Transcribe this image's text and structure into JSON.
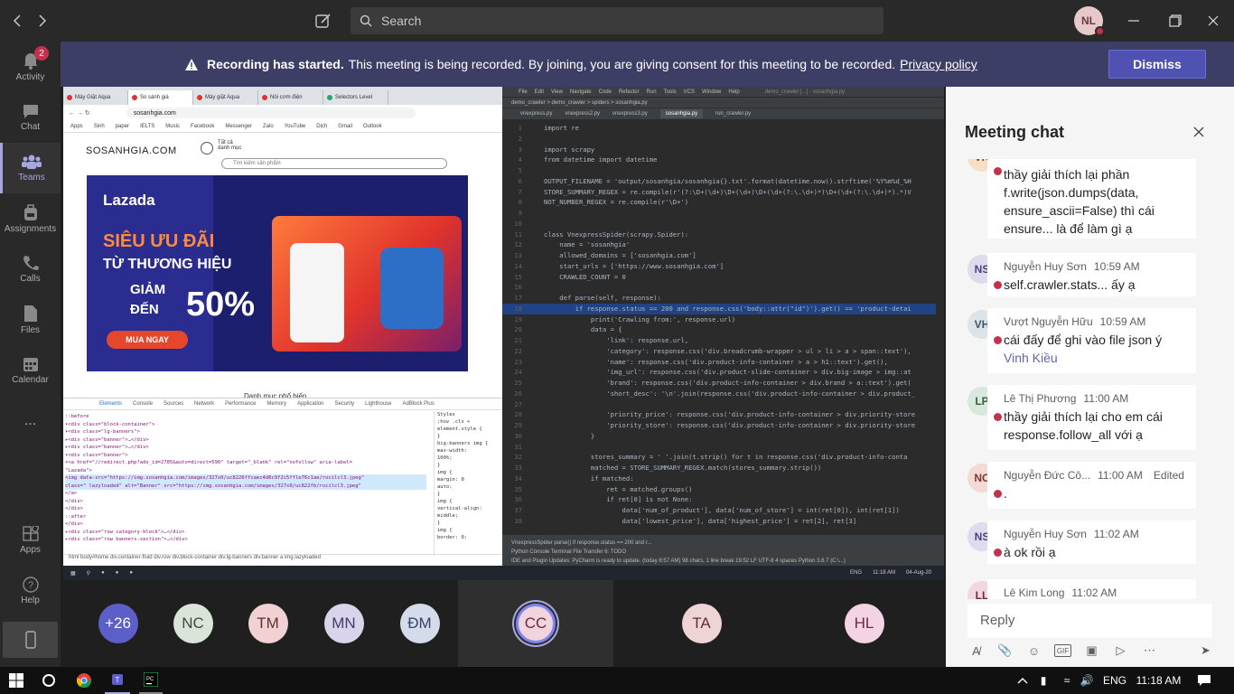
{
  "topbar": {
    "search_placeholder": "Search",
    "user_initials": "NL"
  },
  "rail": {
    "items": [
      {
        "label": "Activity",
        "icon": "bell-icon",
        "badge": "2"
      },
      {
        "label": "Chat",
        "icon": "chat-icon"
      },
      {
        "label": "Teams",
        "icon": "teams-icon"
      },
      {
        "label": "Assignments",
        "icon": "backpack-icon"
      },
      {
        "label": "Calls",
        "icon": "phone-icon"
      },
      {
        "label": "Files",
        "icon": "files-icon"
      },
      {
        "label": "Calendar",
        "icon": "calendar-icon"
      },
      {
        "label": "...",
        "icon": "more-icon"
      },
      {
        "label": "Apps",
        "icon": "apps-icon"
      },
      {
        "label": "Help",
        "icon": "help-icon"
      }
    ]
  },
  "banner": {
    "bold": "Recording has started.",
    "text": "This meeting is being recorded. By joining, you are giving consent for this meeting to be recorded.",
    "link": "Privacy policy",
    "dismiss": "Dismiss"
  },
  "shared": {
    "browser_tabs": [
      "Máy Giặt Aqua",
      "So sánh giá",
      "Máy giặt Aqua",
      "Nồi cơm điện",
      "Selectors Level"
    ],
    "url": "sosanhgia.com",
    "bookmarks": [
      "Apps",
      "Sinh",
      "paper",
      "IELTS",
      "Music",
      "Facebook",
      "Messenger",
      "Zalo",
      "YouTube",
      "Dịch",
      "Gmail",
      "Outlook"
    ],
    "site_logo": "SOSANHGIA.COM",
    "site_menu": "Tất cả danh mục",
    "site_search_placeholder": "Tìm kiếm sản phẩm",
    "ad": {
      "brand": "Lazada",
      "line1": "SIÊU ƯU ĐÃI",
      "line2": "TỪ THƯƠNG HIỆU",
      "line3": "GIẢM",
      "percent": "50%",
      "line4": "ĐẾN",
      "cta": "MUA NGAY"
    },
    "caption": "Danh mục phổ biến",
    "devtools_tabs": [
      "Elements",
      "Console",
      "Sources",
      "Network",
      "Performance",
      "Memory",
      "Application",
      "Security",
      "Lighthouse",
      "AdBlock Plus"
    ],
    "devtools_lines": [
      "::before",
      "▾<div class=\"block-container\">",
      "  ▾<div class=\"lg-banners\">",
      "    ▸<div class=\"banner\">…</div>",
      "    ▸<div class=\"banner\">…</div>",
      "    ▾<div class=\"banner\">",
      "      ▾<a href=\"//redirect.php?ads_id=2785&auto=direct=590\" target=\"_blank\" rel=\"nofollow\" aria-label=",
      "        \"Lazada\">",
      "        <img data-src=\"https://img.sosanhgia.com/images/327x0/uc8226ffcaec4d8c9f2c5ffle76c1ae/rocilcl3.jpeg\"",
      "        class=\" lazyloaded\" alt=\"Banner\" src=\"https://img.sosanhgia.com/images/327x0/uc822fb/rocilcl3.jpeg\"",
      "      </a>",
      "    </div>",
      "  </div>",
      "  ::after",
      "</div>",
      "▸<div class=\"row category-block\">…</div>",
      "▸<div class=\"row banners-section\">…</div>"
    ],
    "devtools_styles": [
      "Styles",
      ":hov .cls +",
      "element.style {",
      "}",
      "big-banners img {",
      "  max-width:",
      "  100%;",
      "}",
      "img {",
      "  margin: 0",
      "  auto;",
      "}",
      "img {",
      "  vertical-align:",
      "  middle;",
      "}",
      "img {",
      "  border: 0;"
    ],
    "devtools_crumbs": "html  body#home  div.container-fluid  div.row  div.block-container  div.lg-banners  div.banner  a  img.lazyloaded",
    "ide_menu": [
      "File",
      "Edit",
      "View",
      "Navigate",
      "Code",
      "Refactor",
      "Run",
      "Tools",
      "VCS",
      "Window",
      "Help"
    ],
    "ide_title": "demo_crawler [...] - sosanhgia.py",
    "ide_breadcrumb": "demo_crawler > demo_crawler > spiders > sosanhgia.py",
    "ide_tabs": [
      "vnexpress.py",
      "vnexpress2.py",
      "vnexpress3.py",
      "sosanhgia.py",
      "run_crawler.py"
    ],
    "ide_code": [
      {
        "n": "1",
        "t": "import re"
      },
      {
        "n": "2",
        "t": ""
      },
      {
        "n": "3",
        "t": "import scrapy"
      },
      {
        "n": "4",
        "t": "from datetime import datetime"
      },
      {
        "n": "5",
        "t": ""
      },
      {
        "n": "6",
        "t": "OUTPUT_FILENAME = 'output/sosanhgia/sosanhgia{}.txt'.format(datetime.now().strftime('%Y%m%d_%H"
      },
      {
        "n": "7",
        "t": "STORE_SUMMARY_REGEX = re.compile(r'(?:\\D+(\\d+)\\D+(\\d+)\\D+(\\d+(?:\\.\\d+)*)\\D+(\\d+(?:\\.\\d+)*).*)V"
      },
      {
        "n": "8",
        "t": "NOT_NUMBER_REGEX = re.compile(r'\\D+')"
      },
      {
        "n": "9",
        "t": ""
      },
      {
        "n": "10",
        "t": ""
      },
      {
        "n": "11",
        "t": "class VnexpressSpider(scrapy.Spider):"
      },
      {
        "n": "12",
        "t": "    name = 'sosanhgia'"
      },
      {
        "n": "13",
        "t": "    allowed_domains = ['sosanhgia.com']"
      },
      {
        "n": "14",
        "t": "    start_urls = ['https://www.sosanhgia.com']"
      },
      {
        "n": "15",
        "t": "    CRAWLED_COUNT = 0"
      },
      {
        "n": "16",
        "t": ""
      },
      {
        "n": "17",
        "t": "    def parse(self, response):"
      },
      {
        "n": "18",
        "t": "        if response.status == 200 and response.css('body::attr(\"id\")').get() == 'product-detai"
      },
      {
        "n": "19",
        "t": "            print('Crawling from:', response.url)"
      },
      {
        "n": "20",
        "t": "            data = {"
      },
      {
        "n": "21",
        "t": "                'link': response.url,"
      },
      {
        "n": "22",
        "t": "                'category': response.css('div.breadcrumb-wrapper > ul > li > a > span::text'),"
      },
      {
        "n": "23",
        "t": "                'name': response.css('div.product-info-container > a > h1::text').get(),"
      },
      {
        "n": "24",
        "t": "                'img_url': response.css('div.product-slide-container > div.big-image > img::at"
      },
      {
        "n": "25",
        "t": "                'brand': response.css('div.product-info-container > div.brand > a::text').get("
      },
      {
        "n": "26",
        "t": "                'short_desc': '\\n'.join(response.css('div.product-info-container > div.product_"
      },
      {
        "n": "27",
        "t": ""
      },
      {
        "n": "28",
        "t": "                'priority_price': response.css('div.product-info-container > div.priority-store"
      },
      {
        "n": "29",
        "t": "                'priority_store': response.css('div.product-info-container > div.priority-store"
      },
      {
        "n": "30",
        "t": "            }"
      },
      {
        "n": "31",
        "t": ""
      },
      {
        "n": "32",
        "t": "            stores_summary = ' '.join(t.strip() for t in response.css('div.product-info-conta"
      },
      {
        "n": "33",
        "t": "            matched = STORE_SUMMARY_REGEX.match(stores_summary.strip())"
      },
      {
        "n": "34",
        "t": "            if matched:"
      },
      {
        "n": "35",
        "t": "                ret = matched.groups()"
      },
      {
        "n": "36",
        "t": "                if ret[0] is not None:"
      },
      {
        "n": "37",
        "t": "                    data['num_of_product'], data['num_of_store'] = int(ret[0]), int(ret[1])"
      },
      {
        "n": "38",
        "t": "                    data['lowest_price'], data['highest_price'] = ret[2], ret[3]"
      }
    ],
    "ide_status": "VnexpressSpider  parse()  if response.status == 200 and r...",
    "ide_tools": "Python Console   Terminal   File Transfer   6: TODO",
    "ide_footer": "IDE and Plugin Updates: PyCharm is ready to update. (today 8:57 AM)      98 chars, 1 line break   19:52  LF  UTF-8  4 spaces  Python 3.6.7 (C:\\...)",
    "shared_clock": "11:18 AM",
    "shared_date": "04-Aug-20",
    "shared_lang": "ENG"
  },
  "participants": [
    {
      "initials": "+26",
      "bg": "#5b5fc7",
      "fg": "#ffffff"
    },
    {
      "initials": "NC",
      "bg": "#dbe4d9",
      "fg": "#3e4a3b"
    },
    {
      "initials": "TM",
      "bg": "#f1d1d2",
      "fg": "#5c3334"
    },
    {
      "initials": "MN",
      "bg": "#d9d4ea",
      "fg": "#44396b"
    },
    {
      "initials": "ĐM",
      "bg": "#d4dbeb",
      "fg": "#364466"
    },
    {
      "initials": "CC",
      "bg": "#f2d4de",
      "fg": "#6b2b3e"
    },
    {
      "initials": "TA",
      "bg": "#efd4d6",
      "fg": "#5c3134"
    },
    {
      "initials": "HL",
      "bg": "#f3d3e4",
      "fg": "#6b2848"
    }
  ],
  "chat": {
    "title": "Meeting chat",
    "reply_placeholder": "Reply",
    "messages": [
      {
        "initials": "VK",
        "bg": "#f6dfc6",
        "fg": "#7a4a1f",
        "name": "",
        "time": "",
        "edited": "",
        "body": "thầy giải thích lại phần f.write(json.dumps(data, ensure_ascii=False) thì cái ensure... là để làm gì ạ",
        "mention": ""
      },
      {
        "initials": "NS",
        "bg": "#dedbec",
        "fg": "#4c4480",
        "name": "Nguyễn Huy Sơn",
        "time": "10:59 AM",
        "edited": "",
        "body": "self.crawler.stats... ấy ạ",
        "mention": ""
      },
      {
        "initials": "VH",
        "bg": "#dce4ea",
        "fg": "#3f5566",
        "name": "Vượt Nguyễn Hữu",
        "time": "10:59 AM",
        "edited": "",
        "body": "cái đấy để ghi vào file json ý",
        "mention": "Vinh Kiều"
      },
      {
        "initials": "LP",
        "bg": "#d8e8dc",
        "fg": "#3a5e44",
        "name": "Lê Thị Phương",
        "time": "11:00 AM",
        "edited": "",
        "body": "thầy giải thích lại cho em cái response.follow_all với ạ",
        "mention": ""
      },
      {
        "initials": "NC",
        "bg": "#f4d9d7",
        "fg": "#7a3a35",
        "name": "Nguyễn Đức Cô...",
        "time": "11:00 AM",
        "edited": "Edited",
        "body": ".",
        "mention": ""
      },
      {
        "initials": "NS",
        "bg": "#dedbec",
        "fg": "#4c4480",
        "name": "Nguyễn Huy Sơn",
        "time": "11:02 AM",
        "edited": "",
        "body": "à ok rồi ạ",
        "mention": ""
      },
      {
        "initials": "LL",
        "bg": "#f3d7de",
        "fg": "#6b2b3e",
        "name": "Lê Kim Long",
        "time": "11:02 AM",
        "edited": "",
        "body": "",
        "mention": ""
      }
    ]
  },
  "taskbar": {
    "lang": "ENG",
    "time": "11:18 AM"
  }
}
